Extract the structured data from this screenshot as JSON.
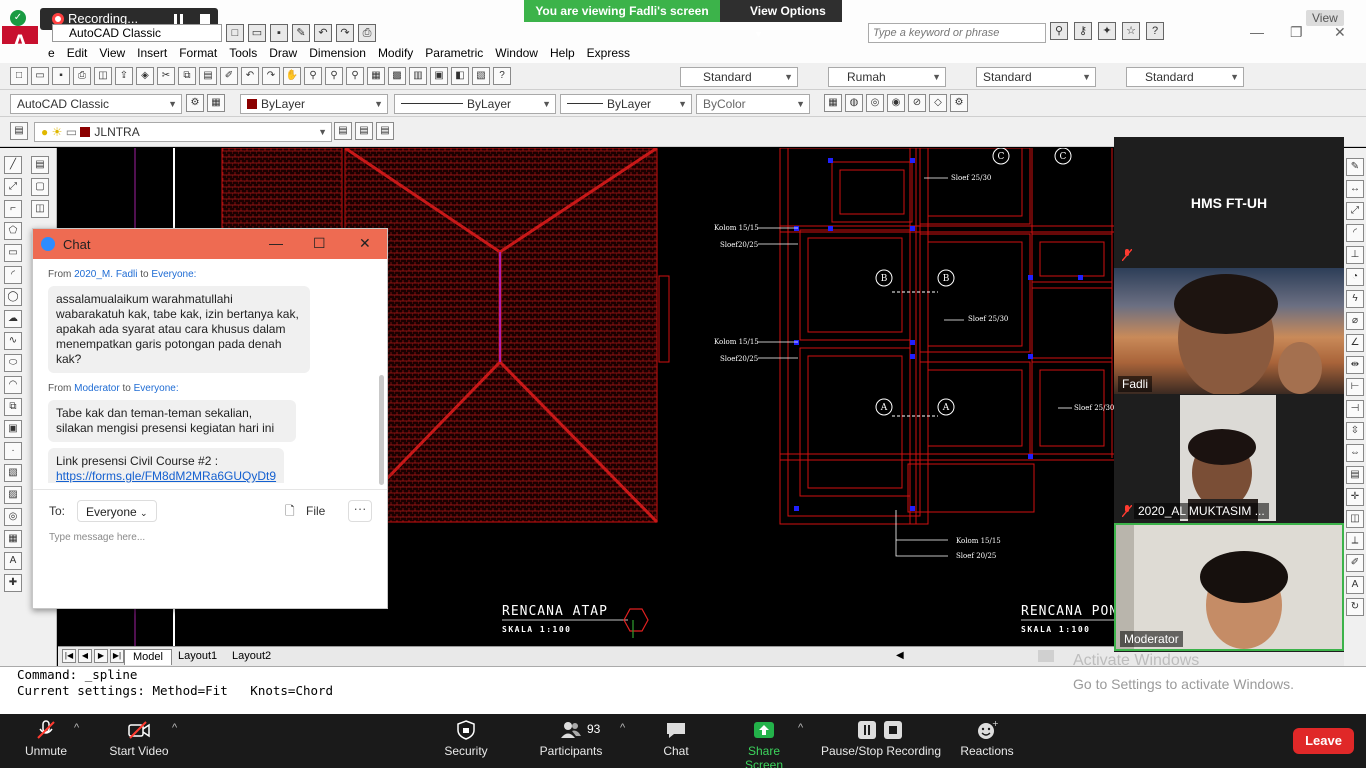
{
  "zoom_banner": {
    "viewing_text": "You are viewing Fadli's screen",
    "view_options": "View Options",
    "recording": "Recording...",
    "view_tag": "View"
  },
  "acad": {
    "title": "AutoCAD Classic",
    "search_placeholder": "Type a keyword or phrase",
    "menu": [
      "e",
      "Edit",
      "View",
      "Insert",
      "Format",
      "Tools",
      "Draw",
      "Dimension",
      "Modify",
      "Parametric",
      "Window",
      "Help",
      "Express"
    ],
    "styles": {
      "text_style": "Standard",
      "dim_style": "Rumah",
      "table_style": "Standard",
      "mleader_style": "Standard"
    },
    "workspace": "AutoCAD Classic",
    "color": "ByLayer",
    "linetype": "ByLayer",
    "lineweight": "ByLayer",
    "plotstyle": "ByColor",
    "layer": "JLNTRA",
    "tabs": [
      "Model",
      "Layout1",
      "Layout2"
    ],
    "command_lines": [
      "Command: _spline",
      "Current settings: Method=Fit   Knots=Chord"
    ],
    "drawing": {
      "title_left": "RENCANA ATAP",
      "scale_left": "SKALA 1:100",
      "title_right": "RENCANA PONI",
      "scale_right": "SKALA 1:100",
      "labels": {
        "sloof_2530_a": "Sloef 25/30",
        "kolom_1515_a": "Kolom 15/15",
        "sloof_2025_a": "Sloef20/25",
        "sloof_2530_b": "Sloef 25/30",
        "kolom_1515_b": "Kolom 15/15",
        "sloof_2025_b": "Sloef20/25",
        "sloof_2530_c": "Sloef 25/30",
        "kolom_1515_c": "Kolom 15/15",
        "sloof_2025_c": "Sloef 20/25"
      },
      "section_marks": [
        "C",
        "C",
        "B",
        "B",
        "A",
        "A"
      ]
    },
    "watermark": {
      "line1": "Activate Windows",
      "line2": "Go to Settings to activate Windows."
    }
  },
  "chat": {
    "title": "Chat",
    "messages": [
      {
        "from_label": "From",
        "sender": "2020_M. Fadli",
        "to_label": "to",
        "recipient": "Everyone:",
        "bubbles": [
          "assalamualaikum warahmatullahi wabarakatuh kak, tabe kak, izin bertanya kak, apakah ada syarat atau cara khusus dalam menempatkan garis potongan pada denah kak?"
        ]
      },
      {
        "from_label": "From",
        "sender": "Moderator",
        "to_label": "to",
        "recipient": "Everyone:",
        "bubbles": [
          "Tabe kak dan teman-teman sekalian, silakan mengisi presensi kegiatan hari ini"
        ]
      }
    ],
    "link_text": "Link presensi Civil Course #2 :",
    "link_url": "https://forms.gle/FM8dM2MRa6GUQyDt9",
    "to_label": "To:",
    "to_value": "Everyone",
    "file_label": "File",
    "input_placeholder": "Type message here..."
  },
  "gallery": {
    "host_tile": "HMS FT-UH",
    "participants": [
      {
        "name": "Fadli"
      },
      {
        "name": "2020_AL MUKTASIM ..."
      },
      {
        "name": "Moderator"
      }
    ]
  },
  "zoom_bar": {
    "unmute": "Unmute",
    "start_video": "Start Video",
    "security": "Security",
    "participants": "Participants",
    "participant_count": "93",
    "chat": "Chat",
    "share_screen": "Share Screen",
    "pause_stop": "Pause/Stop Recording",
    "reactions": "Reactions",
    "leave": "Leave"
  }
}
